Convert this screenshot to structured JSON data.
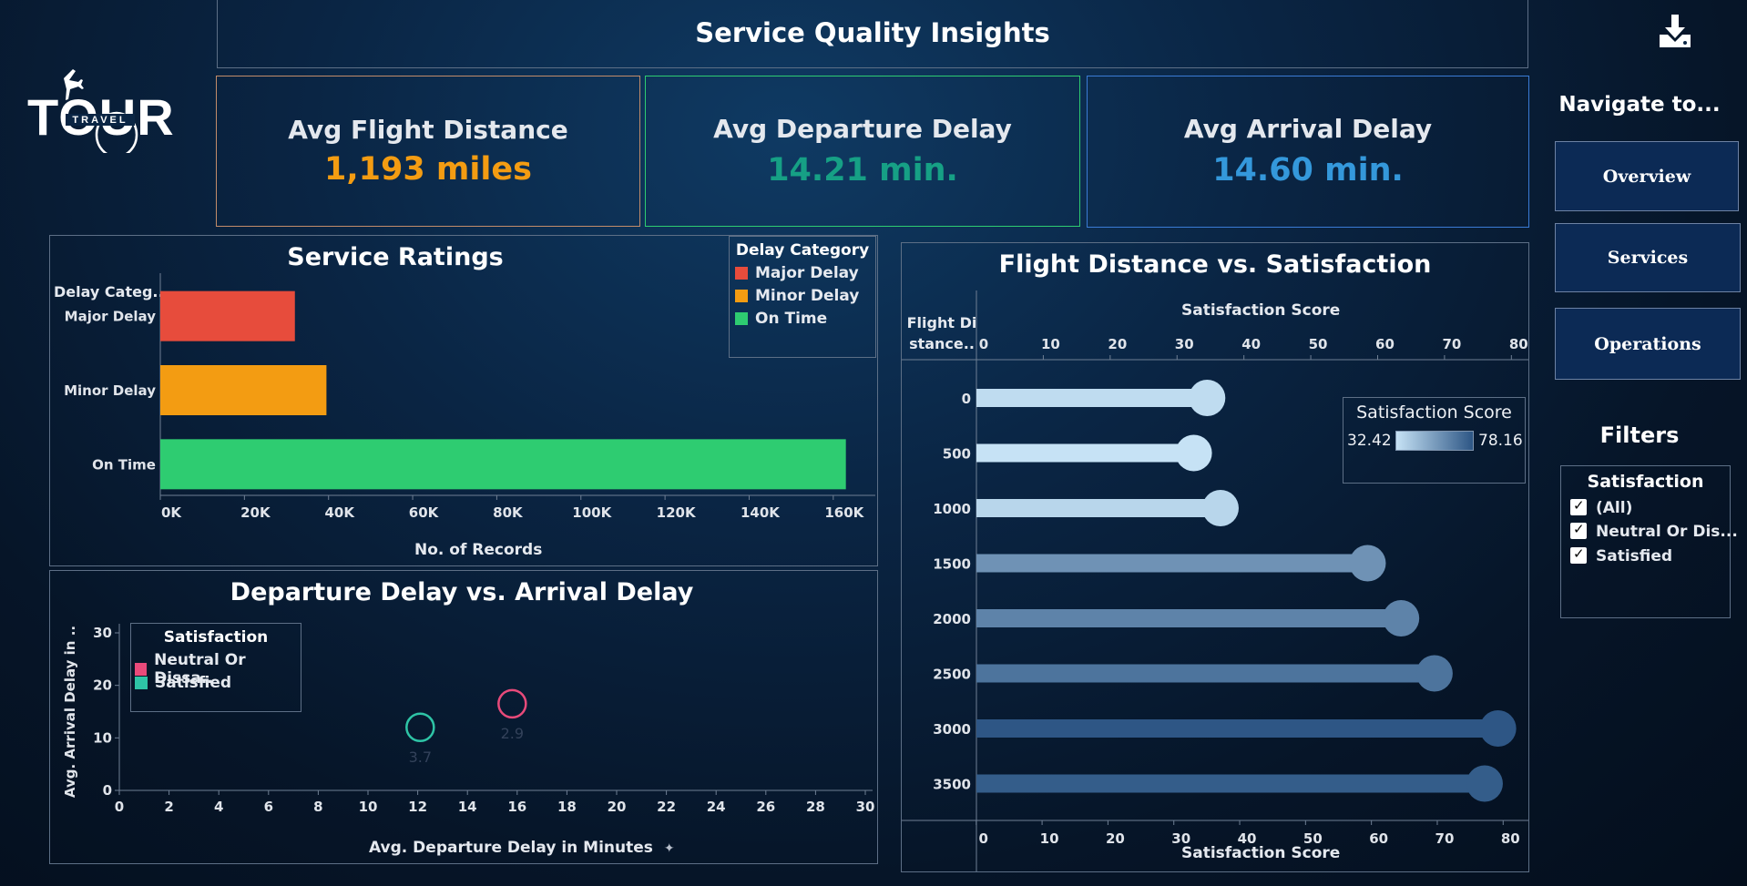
{
  "header": {
    "title": "Service Quality Insights",
    "download_icon": "download-icon"
  },
  "logo": {
    "main": "TOUR",
    "sub": "TRAVEL"
  },
  "kpis": [
    {
      "label": "Avg Flight Distance",
      "value": "1,193 miles",
      "color": "#f39c12",
      "border": "#c28c6a"
    },
    {
      "label": "Avg Departure Delay",
      "value": "14.21 min.",
      "color": "#16a085",
      "border": "#2ecc71"
    },
    {
      "label": "Avg Arrival Delay",
      "value": "14.60 min.",
      "color": "#3498db",
      "border": "#3a7bd5"
    }
  ],
  "nav": {
    "title": "Navigate to...",
    "buttons": [
      "Overview",
      "Services",
      "Operations"
    ]
  },
  "filters": {
    "title": "Filters",
    "group_title": "Satisfaction",
    "options": [
      "(All)",
      "Neutral Or Dis...",
      "Satisfied"
    ]
  },
  "service_ratings": {
    "title": "Service Ratings",
    "row_header": "Delay Categ..",
    "legend_title": "Delay Category",
    "legend": [
      {
        "name": "Major Delay",
        "color": "#e74c3c"
      },
      {
        "name": "Minor Delay",
        "color": "#f39c12"
      },
      {
        "name": "On Time",
        "color": "#2ecc71"
      }
    ],
    "xlabel": "No. of Records"
  },
  "delay_scatter": {
    "title": "Departure Delay vs. Arrival Delay",
    "legend_title": "Satisfaction",
    "legend": [
      {
        "name": "Neutral Or Dissa..",
        "color": "#e84a7a"
      },
      {
        "name": "Satisfied",
        "color": "#2ec4a6"
      }
    ],
    "xlabel": "Avg. Departure Delay in Minutes",
    "ylabel": "Avg. Arrival Delay in ..",
    "sort_icon": "pin-icon"
  },
  "distance_chart": {
    "title": "Flight Distance vs. Satisfaction",
    "row_header": "Flight Di stance..",
    "top_axis_label": "Satisfaction Score",
    "bottom_axis_label": "Satisfaction Score",
    "legend_title": "Satisfaction Score",
    "legend_min": "32.42",
    "legend_max": "78.16"
  },
  "chart_data": [
    {
      "type": "bar",
      "orientation": "horizontal",
      "title": "Service Ratings",
      "categories": [
        "Major Delay",
        "Minor Delay",
        "On Time"
      ],
      "values": [
        32000,
        39500,
        163000
      ],
      "colors": [
        "#e74c3c",
        "#f39c12",
        "#2ecc71"
      ],
      "xlabel": "No. of Records",
      "xlim": [
        0,
        170000
      ],
      "xticks": [
        0,
        20000,
        40000,
        60000,
        80000,
        100000,
        120000,
        140000,
        160000
      ],
      "xtick_labels": [
        "0K",
        "20K",
        "40K",
        "60K",
        "80K",
        "100K",
        "120K",
        "140K",
        "160K"
      ],
      "grid": false,
      "legend_position": "top-right"
    },
    {
      "type": "scatter",
      "title": "Departure Delay vs. Arrival Delay",
      "xlabel": "Avg. Departure Delay in Minutes",
      "ylabel": "Avg. Arrival Delay in ..",
      "xlim": [
        0,
        30
      ],
      "ylim": [
        0,
        30
      ],
      "xticks": [
        0,
        2,
        4,
        6,
        8,
        10,
        12,
        14,
        16,
        18,
        20,
        22,
        24,
        26,
        28,
        30
      ],
      "yticks": [
        0,
        10,
        20,
        30
      ],
      "series": [
        {
          "name": "Neutral Or Dissa..",
          "color": "#e84a7a",
          "points": [
            {
              "x": 15.8,
              "y": 16.5,
              "label": "2.9"
            }
          ]
        },
        {
          "name": "Satisfied",
          "color": "#2ec4a6",
          "points": [
            {
              "x": 12.1,
              "y": 12.0,
              "label": "3.7"
            }
          ]
        }
      ],
      "legend_position": "top-left"
    },
    {
      "type": "bar",
      "orientation": "horizontal",
      "style": "lollipop",
      "title": "Flight Distance vs. Satisfaction",
      "categories": [
        "0",
        "500",
        "1000",
        "1500",
        "2000",
        "2500",
        "3000",
        "3500"
      ],
      "values": [
        34.5,
        32.5,
        36.5,
        58.5,
        63.5,
        68.5,
        78.0,
        76.0
      ],
      "xlabel": "Satisfaction Score",
      "xlim": [
        0,
        82
      ],
      "top_xticks": [
        0,
        10,
        20,
        30,
        40,
        50,
        60,
        70,
        80
      ],
      "bottom_xticks": [
        0,
        10,
        20,
        30,
        40,
        50,
        60,
        70,
        80
      ],
      "color_scale": {
        "min": 32.42,
        "max": 78.16,
        "low_color": "#c6e2f5",
        "high_color": "#2d5685"
      },
      "legend_position": "top-right"
    }
  ]
}
